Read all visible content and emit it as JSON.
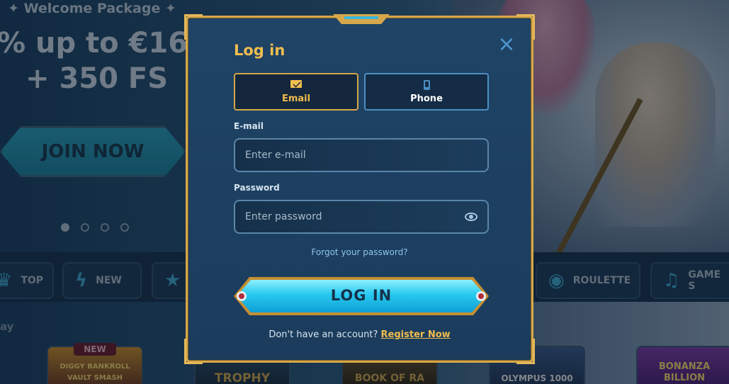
{
  "background": {
    "welcome_package": "✦ Welcome Package ✦",
    "promo_line1": "% up to €16",
    "promo_line2": "+ 350 FS",
    "join_button": "JOIN NOW",
    "categories": [
      {
        "label": "TOP",
        "icon": "crown-icon"
      },
      {
        "label": "NEW",
        "icon": "lightning-icon"
      },
      {
        "label": "",
        "icon": "star-icon"
      },
      {
        "label": "ROULETTE",
        "icon": "roulette-icon"
      },
      {
        "label": "GAME S",
        "icon": "microphone-icon"
      }
    ],
    "section_title": "ay",
    "new_tag": "NEW",
    "games": [
      "DIGGY BANKROLL VAULT SMASH",
      "TROPHY",
      "BOOK OF RA",
      "OLYMPUS 1000",
      "BONANZA BILLION"
    ]
  },
  "modal": {
    "title": "Log in",
    "close_icon": "close-icon",
    "tabs": [
      {
        "label": "Email",
        "icon": "envelope-icon",
        "active": true
      },
      {
        "label": "Phone",
        "icon": "phone-icon",
        "active": false
      }
    ],
    "email_label": "E-mail",
    "email_placeholder": "Enter e-mail",
    "password_label": "Password",
    "password_placeholder": "Enter password",
    "forgot_link": "Forgot your password?",
    "login_button": "LOG IN",
    "no_account_text": "Don't have an account?",
    "register_link": "Register Now"
  },
  "colors": {
    "gold_accent": "#f0bd4e",
    "frame_gold": "#d6a74a",
    "modal_bg": "#1f4466",
    "button_cyan": "#27c9f0"
  }
}
